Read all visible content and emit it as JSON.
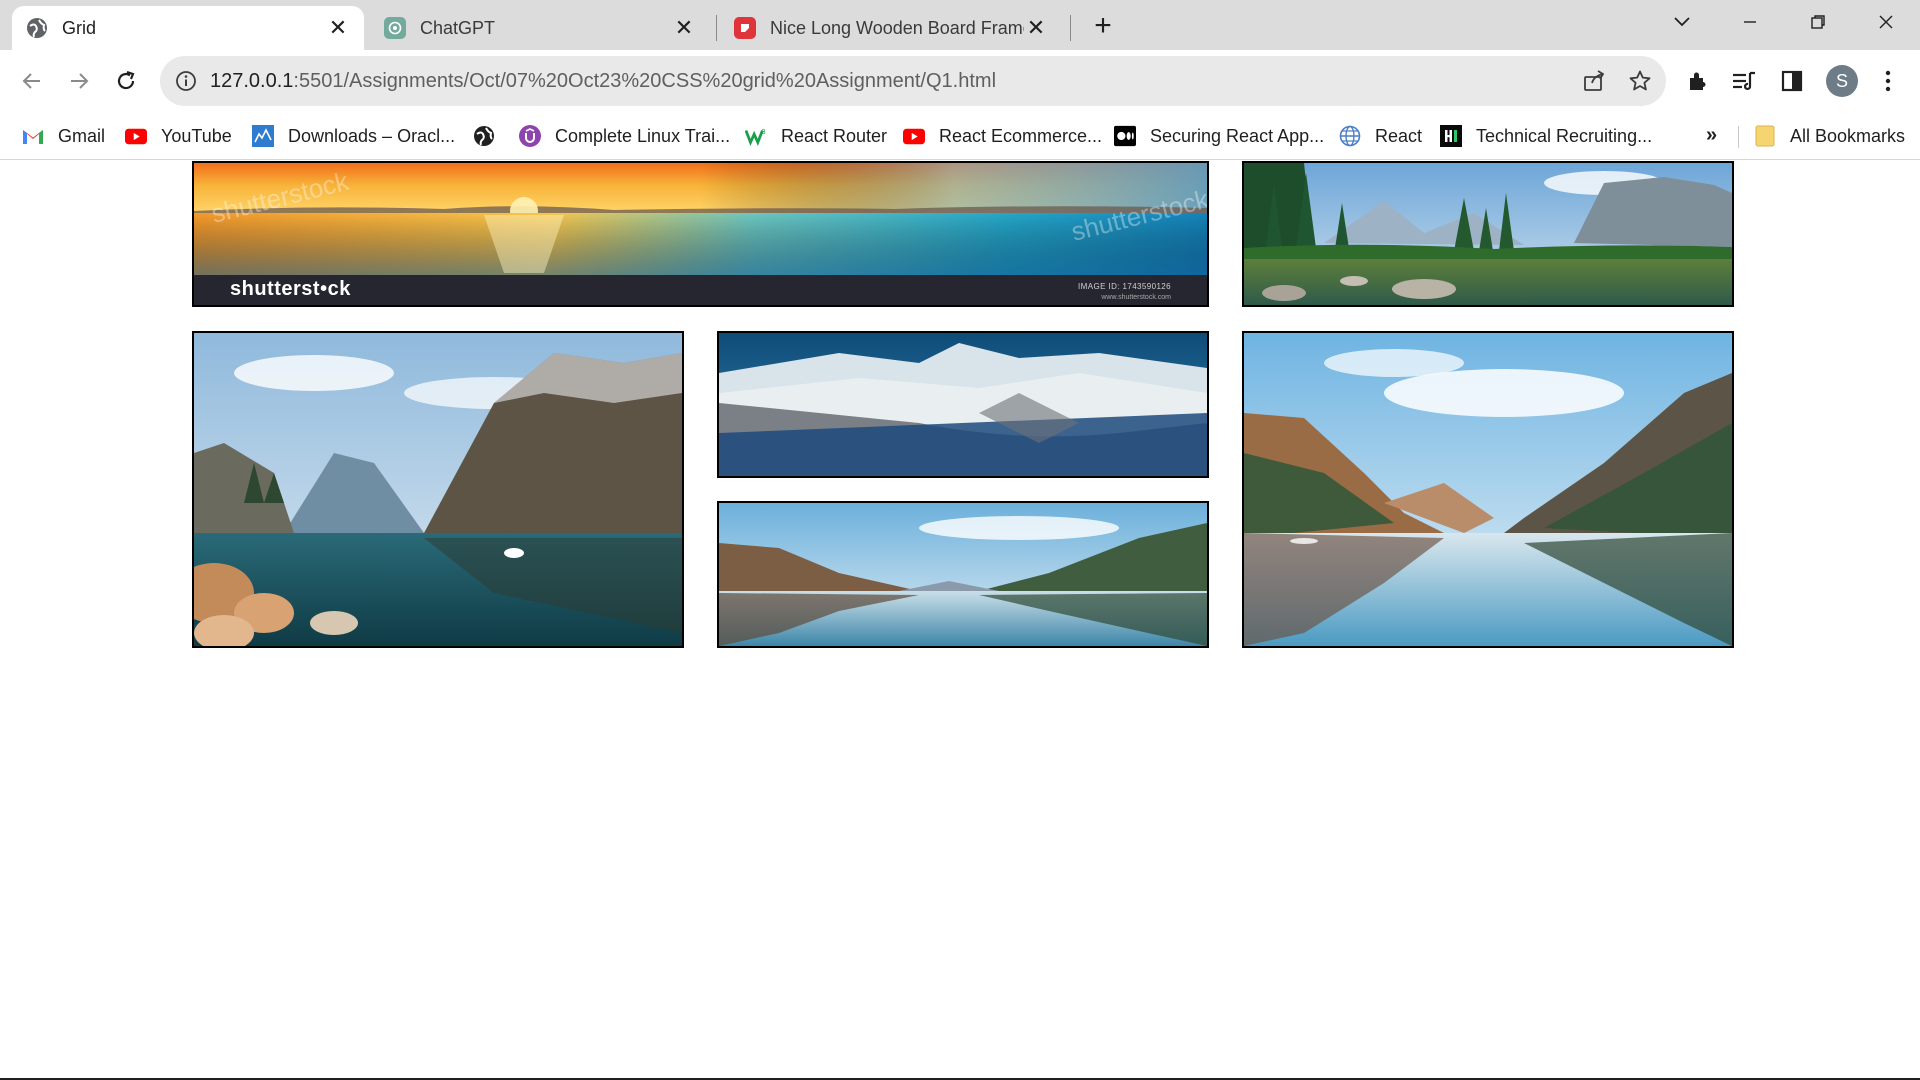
{
  "tabs": [
    {
      "title": "Grid",
      "active": true,
      "icon": "globe-icon"
    },
    {
      "title": "ChatGPT",
      "active": false,
      "icon": "chatgpt-icon"
    },
    {
      "title": "Nice Long Wooden Board Frame",
      "active": false,
      "icon": "app-red-icon"
    }
  ],
  "address_bar": {
    "host": "127.0.0.1",
    "path": ":5501/Assignments/Oct/07%20Oct23%20CSS%20grid%20Assignment/Q1.html"
  },
  "bookmarks": [
    {
      "label": "Gmail",
      "icon": "gmail-icon"
    },
    {
      "label": "YouTube",
      "icon": "youtube-icon"
    },
    {
      "label": "Downloads – Oracl...",
      "icon": "oracle-icon"
    },
    {
      "label": "",
      "icon": "globe-icon"
    },
    {
      "label": "Complete Linux Trai...",
      "icon": "udemy-icon"
    },
    {
      "label": "React Router",
      "icon": "react-router-icon"
    },
    {
      "label": "React Ecommerce...",
      "icon": "youtube-icon"
    },
    {
      "label": "Securing React App...",
      "icon": "medium-icon"
    },
    {
      "label": "React",
      "icon": "web-icon"
    },
    {
      "label": "Technical Recruiting...",
      "icon": "hackerrank-icon"
    }
  ],
  "all_bookmarks_label": "All Bookmarks",
  "profile_initial": "S",
  "grid_images": [
    {
      "name": "sunset-lake",
      "watermark": {
        "logo": "shutterst•ck",
        "image_id": "IMAGE ID: 1743590126",
        "site": "www.shutterstock.com"
      }
    },
    {
      "name": "forest-river"
    },
    {
      "name": "fjord-cliffs"
    },
    {
      "name": "snowy-mountains"
    },
    {
      "name": "lake-reflection"
    },
    {
      "name": "fjord-reflection"
    }
  ],
  "colors": {
    "tab_strip": "#dcdcdc",
    "omnibox": "#e9e9e9",
    "image_border": "#000000"
  }
}
